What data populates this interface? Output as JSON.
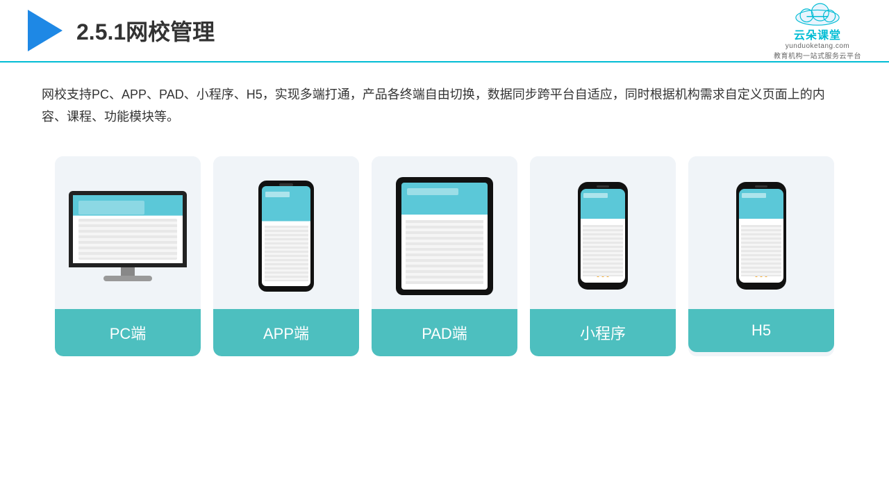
{
  "header": {
    "title": "2.5.1网校管理",
    "brand_main": "云朵课堂",
    "brand_url": "yunduoketang.com",
    "brand_slogan": "教育机构一站",
    "brand_slogan2": "式服务云平台"
  },
  "description": "网校支持PC、APP、PAD、小程序、H5，实现多端打通，产品各终端自由切换，数据同步跨平台自适应，同时根据机构需求自定义页面上的内容、课程、功能模块等。",
  "cards": [
    {
      "label": "PC端",
      "type": "pc"
    },
    {
      "label": "APP端",
      "type": "phone"
    },
    {
      "label": "PAD端",
      "type": "tablet"
    },
    {
      "label": "小程序",
      "type": "thin-phone"
    },
    {
      "label": "H5",
      "type": "thin-phone"
    }
  ],
  "colors": {
    "accent": "#00bcd4",
    "card_bg": "#f0f4f8",
    "card_label_bg": "#4dbfbf",
    "title_color": "#333"
  }
}
